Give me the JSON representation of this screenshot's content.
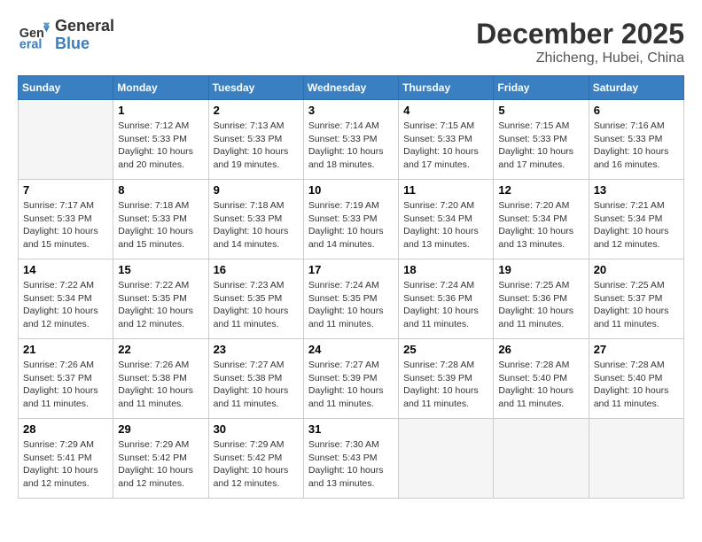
{
  "logo": {
    "line1": "General",
    "line2": "Blue"
  },
  "title": "December 2025",
  "location": "Zhicheng, Hubei, China",
  "weekdays": [
    "Sunday",
    "Monday",
    "Tuesday",
    "Wednesday",
    "Thursday",
    "Friday",
    "Saturday"
  ],
  "weeks": [
    [
      {
        "day": null,
        "info": null
      },
      {
        "day": "1",
        "info": "Sunrise: 7:12 AM\nSunset: 5:33 PM\nDaylight: 10 hours\nand 20 minutes."
      },
      {
        "day": "2",
        "info": "Sunrise: 7:13 AM\nSunset: 5:33 PM\nDaylight: 10 hours\nand 19 minutes."
      },
      {
        "day": "3",
        "info": "Sunrise: 7:14 AM\nSunset: 5:33 PM\nDaylight: 10 hours\nand 18 minutes."
      },
      {
        "day": "4",
        "info": "Sunrise: 7:15 AM\nSunset: 5:33 PM\nDaylight: 10 hours\nand 17 minutes."
      },
      {
        "day": "5",
        "info": "Sunrise: 7:15 AM\nSunset: 5:33 PM\nDaylight: 10 hours\nand 17 minutes."
      },
      {
        "day": "6",
        "info": "Sunrise: 7:16 AM\nSunset: 5:33 PM\nDaylight: 10 hours\nand 16 minutes."
      }
    ],
    [
      {
        "day": "7",
        "info": "Sunrise: 7:17 AM\nSunset: 5:33 PM\nDaylight: 10 hours\nand 15 minutes."
      },
      {
        "day": "8",
        "info": "Sunrise: 7:18 AM\nSunset: 5:33 PM\nDaylight: 10 hours\nand 15 minutes."
      },
      {
        "day": "9",
        "info": "Sunrise: 7:18 AM\nSunset: 5:33 PM\nDaylight: 10 hours\nand 14 minutes."
      },
      {
        "day": "10",
        "info": "Sunrise: 7:19 AM\nSunset: 5:33 PM\nDaylight: 10 hours\nand 14 minutes."
      },
      {
        "day": "11",
        "info": "Sunrise: 7:20 AM\nSunset: 5:34 PM\nDaylight: 10 hours\nand 13 minutes."
      },
      {
        "day": "12",
        "info": "Sunrise: 7:20 AM\nSunset: 5:34 PM\nDaylight: 10 hours\nand 13 minutes."
      },
      {
        "day": "13",
        "info": "Sunrise: 7:21 AM\nSunset: 5:34 PM\nDaylight: 10 hours\nand 12 minutes."
      }
    ],
    [
      {
        "day": "14",
        "info": "Sunrise: 7:22 AM\nSunset: 5:34 PM\nDaylight: 10 hours\nand 12 minutes."
      },
      {
        "day": "15",
        "info": "Sunrise: 7:22 AM\nSunset: 5:35 PM\nDaylight: 10 hours\nand 12 minutes."
      },
      {
        "day": "16",
        "info": "Sunrise: 7:23 AM\nSunset: 5:35 PM\nDaylight: 10 hours\nand 11 minutes."
      },
      {
        "day": "17",
        "info": "Sunrise: 7:24 AM\nSunset: 5:35 PM\nDaylight: 10 hours\nand 11 minutes."
      },
      {
        "day": "18",
        "info": "Sunrise: 7:24 AM\nSunset: 5:36 PM\nDaylight: 10 hours\nand 11 minutes."
      },
      {
        "day": "19",
        "info": "Sunrise: 7:25 AM\nSunset: 5:36 PM\nDaylight: 10 hours\nand 11 minutes."
      },
      {
        "day": "20",
        "info": "Sunrise: 7:25 AM\nSunset: 5:37 PM\nDaylight: 10 hours\nand 11 minutes."
      }
    ],
    [
      {
        "day": "21",
        "info": "Sunrise: 7:26 AM\nSunset: 5:37 PM\nDaylight: 10 hours\nand 11 minutes."
      },
      {
        "day": "22",
        "info": "Sunrise: 7:26 AM\nSunset: 5:38 PM\nDaylight: 10 hours\nand 11 minutes."
      },
      {
        "day": "23",
        "info": "Sunrise: 7:27 AM\nSunset: 5:38 PM\nDaylight: 10 hours\nand 11 minutes."
      },
      {
        "day": "24",
        "info": "Sunrise: 7:27 AM\nSunset: 5:39 PM\nDaylight: 10 hours\nand 11 minutes."
      },
      {
        "day": "25",
        "info": "Sunrise: 7:28 AM\nSunset: 5:39 PM\nDaylight: 10 hours\nand 11 minutes."
      },
      {
        "day": "26",
        "info": "Sunrise: 7:28 AM\nSunset: 5:40 PM\nDaylight: 10 hours\nand 11 minutes."
      },
      {
        "day": "27",
        "info": "Sunrise: 7:28 AM\nSunset: 5:40 PM\nDaylight: 10 hours\nand 11 minutes."
      }
    ],
    [
      {
        "day": "28",
        "info": "Sunrise: 7:29 AM\nSunset: 5:41 PM\nDaylight: 10 hours\nand 12 minutes."
      },
      {
        "day": "29",
        "info": "Sunrise: 7:29 AM\nSunset: 5:42 PM\nDaylight: 10 hours\nand 12 minutes."
      },
      {
        "day": "30",
        "info": "Sunrise: 7:29 AM\nSunset: 5:42 PM\nDaylight: 10 hours\nand 12 minutes."
      },
      {
        "day": "31",
        "info": "Sunrise: 7:30 AM\nSunset: 5:43 PM\nDaylight: 10 hours\nand 13 minutes."
      },
      {
        "day": null,
        "info": null
      },
      {
        "day": null,
        "info": null
      },
      {
        "day": null,
        "info": null
      }
    ]
  ]
}
